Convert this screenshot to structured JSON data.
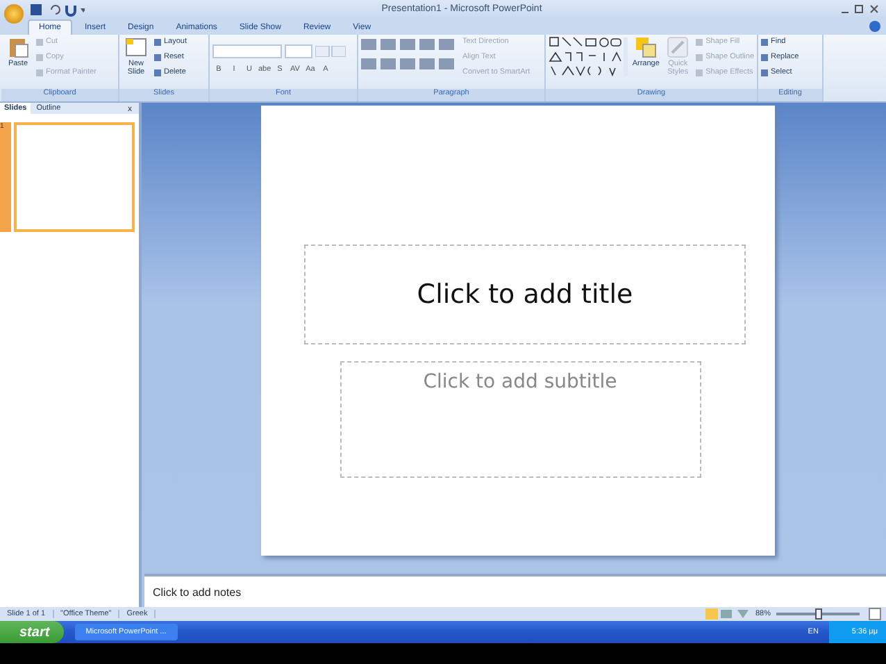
{
  "window": {
    "title": "Presentation1 - Microsoft PowerPoint"
  },
  "tabs": [
    {
      "label": "Home",
      "selected": true
    },
    {
      "label": "Insert",
      "selected": false
    },
    {
      "label": "Design",
      "selected": false
    },
    {
      "label": "Animations",
      "selected": false
    },
    {
      "label": "Slide Show",
      "selected": false
    },
    {
      "label": "Review",
      "selected": false
    },
    {
      "label": "View",
      "selected": false
    }
  ],
  "ribbon": {
    "groups": [
      {
        "label": "Clipboard",
        "big": {
          "label": "Paste",
          "kind": "paste"
        },
        "small": [
          {
            "label": "Cut",
            "disabled": true
          },
          {
            "label": "Copy",
            "disabled": true
          },
          {
            "label": "Format Painter",
            "disabled": true
          }
        ]
      },
      {
        "label": "Slides",
        "big": {
          "label": "New Slide",
          "kind": "slide"
        },
        "small": [
          {
            "label": "Layout",
            "disabled": false
          },
          {
            "label": "Reset",
            "disabled": false
          },
          {
            "label": "Delete",
            "disabled": false
          }
        ]
      },
      {
        "label": "Font",
        "kind": "font",
        "format": [
          "B",
          "I",
          "U",
          "abe",
          "S",
          "AV",
          "Aa",
          "A"
        ]
      },
      {
        "label": "Paragraph",
        "kind": "paragraph",
        "small": [
          {
            "label": "Text Direction",
            "disabled": true
          },
          {
            "label": "Align Text",
            "disabled": true
          },
          {
            "label": "Convert to SmartArt",
            "disabled": true
          }
        ]
      },
      {
        "label": "Drawing",
        "kind": "drawing",
        "big": {
          "label": "Arrange",
          "kind": "arrange"
        },
        "quick": {
          "label": "Quick Styles",
          "disabled": true
        },
        "small": [
          {
            "label": "Shape Fill",
            "disabled": true
          },
          {
            "label": "Shape Outline",
            "disabled": true
          },
          {
            "label": "Shape Effects",
            "disabled": true
          }
        ]
      },
      {
        "label": "Editing",
        "small": [
          {
            "label": "Find",
            "disabled": false
          },
          {
            "label": "Replace",
            "disabled": false
          },
          {
            "label": "Select",
            "disabled": false
          }
        ]
      }
    ]
  },
  "panel": {
    "tabs": [
      {
        "label": "Slides",
        "selected": true
      },
      {
        "label": "Outline",
        "selected": false
      }
    ],
    "close": "x",
    "thumbnails": [
      {
        "number": "1",
        "selected": true
      }
    ]
  },
  "slide": {
    "title_placeholder": "Click to add title",
    "subtitle_placeholder": "Click to add subtitle"
  },
  "notes": {
    "placeholder": "Click to add notes"
  },
  "status_bar": {
    "items": [
      "Slide 1 of 1",
      "\"Office Theme\"",
      "Greek"
    ],
    "zoom": "88%",
    "zoom_slider": {
      "level": 0.5
    }
  },
  "taskbar": {
    "start": "start",
    "windows": [
      {
        "label": "Microsoft PowerPoint ..."
      }
    ],
    "language": "EN",
    "clock": "5:36 μμ"
  }
}
